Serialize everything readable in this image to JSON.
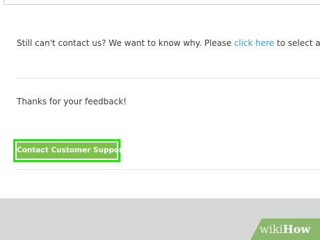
{
  "contact_section": {
    "intro_text": "Still can't contact us? We want to know why. Please ",
    "link_text": "click here",
    "after_link_text": " to select a reason so that"
  },
  "feedback": {
    "thanks_text": "Thanks for your feedback!"
  },
  "cta": {
    "label": "Contact Customer Support"
  },
  "watermark": {
    "wiki": "wiki",
    "how": "How"
  },
  "colors": {
    "link": "#2a9fd8",
    "button": "#7cc24a",
    "highlight": "#2fe019",
    "footer": "#d6d8d5"
  }
}
